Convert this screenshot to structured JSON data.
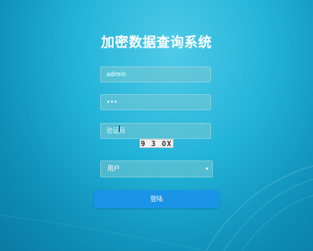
{
  "page": {
    "title": "加密数据查询系统"
  },
  "form": {
    "username_value": "admin",
    "password_value": "•••",
    "captcha_placeholder": "验证码",
    "captcha_image_text": "9 3 OX",
    "role_selected": "用户",
    "role_arrow": "▾",
    "login_label": "登陆"
  },
  "colors": {
    "background": "#22b3d9",
    "button": "#1a94e6",
    "field": "#78c8d2"
  }
}
